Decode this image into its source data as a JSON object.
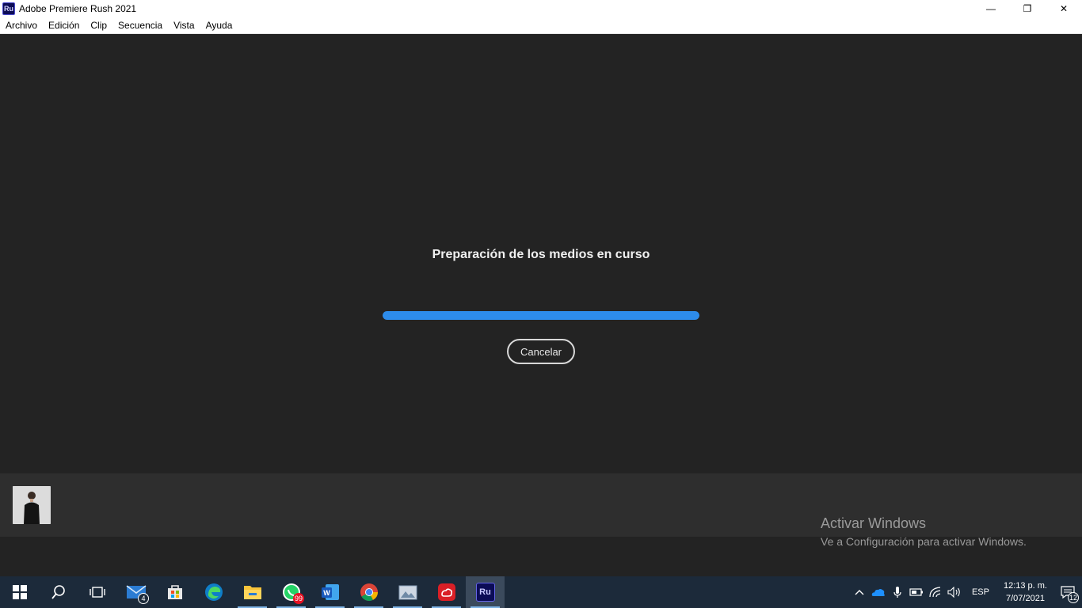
{
  "window": {
    "app_icon_text": "Ru",
    "title": "Adobe Premiere Rush 2021",
    "minimize_glyph": "—",
    "restore_glyph": "❐",
    "close_glyph": "✕"
  },
  "menu": {
    "items": [
      "Archivo",
      "Edición",
      "Clip",
      "Secuencia",
      "Vista",
      "Ayuda"
    ]
  },
  "dialog": {
    "title": "Preparación de los medios en curso",
    "progress_fraction": 1.0,
    "cancel_label": "Cancelar"
  },
  "watermark": {
    "line1": "Activar Windows",
    "line2": "Ve a Configuración para activar Windows."
  },
  "taskbar": {
    "apps": [
      {
        "name": "start",
        "icon": "windows-logo-icon"
      },
      {
        "name": "search",
        "icon": "search-icon"
      },
      {
        "name": "task-view",
        "icon": "task-view-icon"
      },
      {
        "name": "mail",
        "icon": "mail-icon",
        "badge": "4"
      },
      {
        "name": "store",
        "icon": "store-icon"
      },
      {
        "name": "edge",
        "icon": "edge-icon"
      },
      {
        "name": "file-explorer",
        "icon": "folder-icon"
      },
      {
        "name": "whatsapp",
        "icon": "whatsapp-icon",
        "badge": "99"
      },
      {
        "name": "word",
        "icon": "word-icon"
      },
      {
        "name": "chrome",
        "icon": "chrome-icon"
      },
      {
        "name": "photos",
        "icon": "photos-icon"
      },
      {
        "name": "creative-cloud",
        "icon": "creative-cloud-icon"
      },
      {
        "name": "premiere-rush",
        "icon": "premiere-rush-icon",
        "label": "Ru"
      }
    ],
    "tray": {
      "language": "ESP",
      "time": "12:13 p. m.",
      "date": "7/07/2021",
      "notifications": "12"
    }
  },
  "colors": {
    "accent": "#2d8ceb",
    "background": "#232323",
    "taskbar": "#1c2a3a"
  }
}
